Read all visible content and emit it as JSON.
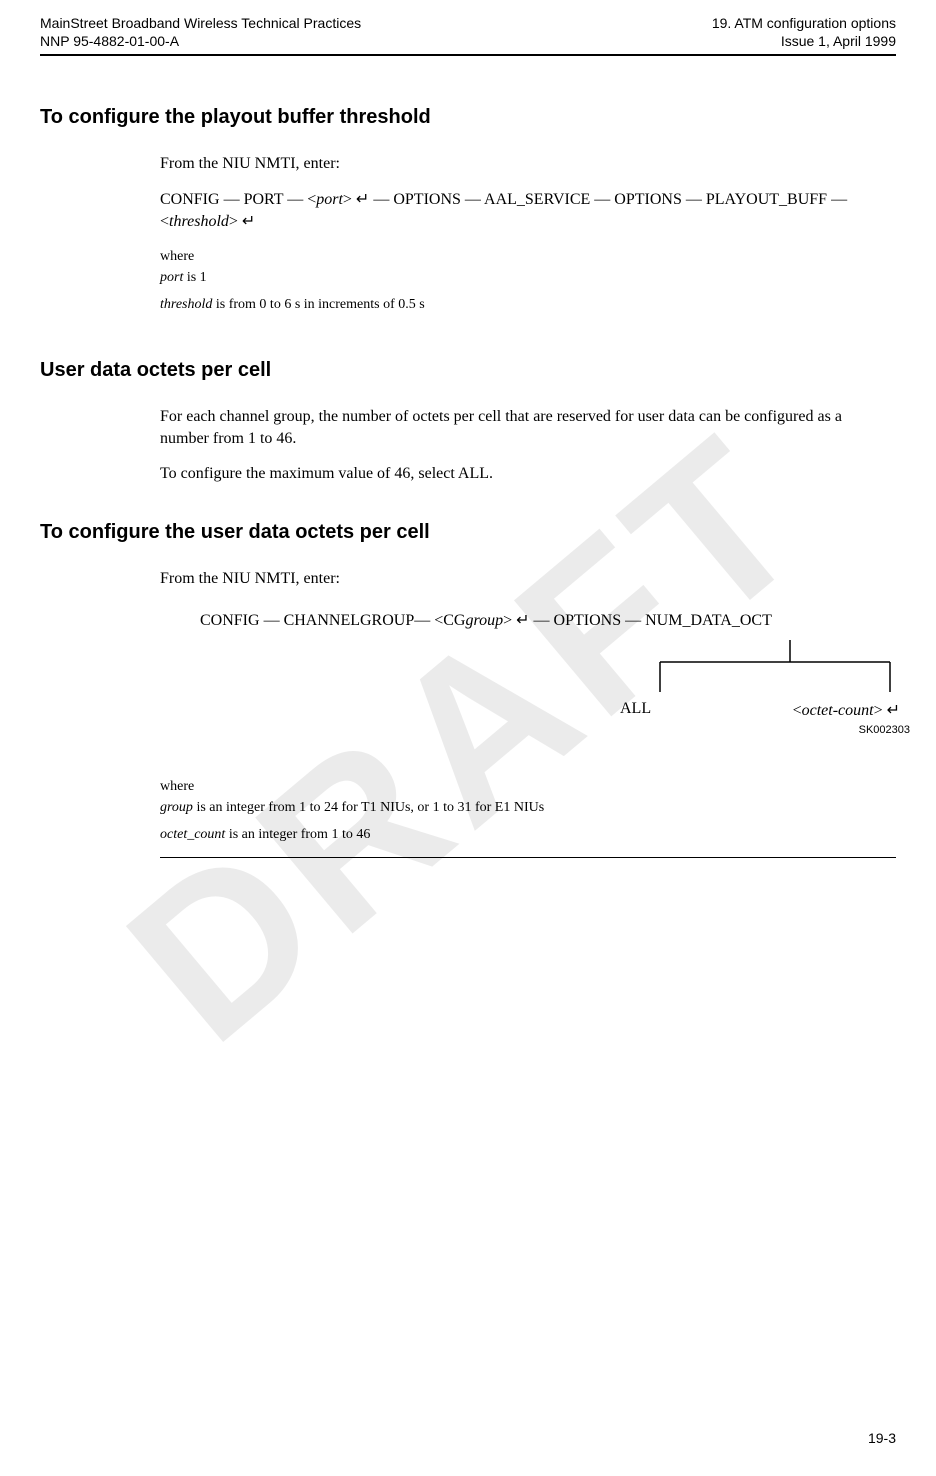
{
  "header": {
    "left1": "MainStreet Broadband Wireless Technical Practices",
    "left2": "NNP 95-4882-01-00-A",
    "right1": "19. ATM configuration options",
    "right2": "Issue 1, April 1999"
  },
  "watermark": "DRAFT",
  "section1": {
    "heading": "To configure the playout buffer threshold",
    "intro": "From the NIU NMTI, enter:",
    "cmd": "CONFIG — PORT — <port> ↵ — OPTIONS — AAL_SERVICE — OPTIONS — PLAYOUT_BUFF — <threshold> ↵",
    "where": "where",
    "port_label": "port",
    "port_desc": " is 1",
    "threshold_label": "threshold",
    "threshold_desc": " is from 0 to 6 s in increments of 0.5 s"
  },
  "section2": {
    "heading": "User data octets per cell",
    "p1": "For each channel group, the number of octets per cell that are reserved for user data can be configured as a number from 1 to 46.",
    "p2": "To configure the maximum value of 46, select ALL."
  },
  "section3": {
    "heading": "To configure the user data octets per cell",
    "intro": "From the NIU NMTI, enter:",
    "cmd_prefix": "CONFIG — CHANNELGROUP— <CG",
    "cmd_group": "group",
    "cmd_suffix": "> ↵ — OPTIONS — NUM_DATA_OCT",
    "branch_all": "ALL",
    "branch_octet_prefix": "<",
    "branch_octet": "octet-count",
    "branch_octet_suffix": "> ↵",
    "fig_id": "SK002303",
    "where": "where",
    "group_label": "group",
    "group_desc": " is an integer from 1 to 24 for T1 NIUs, or 1 to 31 for E1  NIUs",
    "octet_label": "octet_count",
    "octet_desc": " is an integer from 1 to 46"
  },
  "footer": "19-3"
}
